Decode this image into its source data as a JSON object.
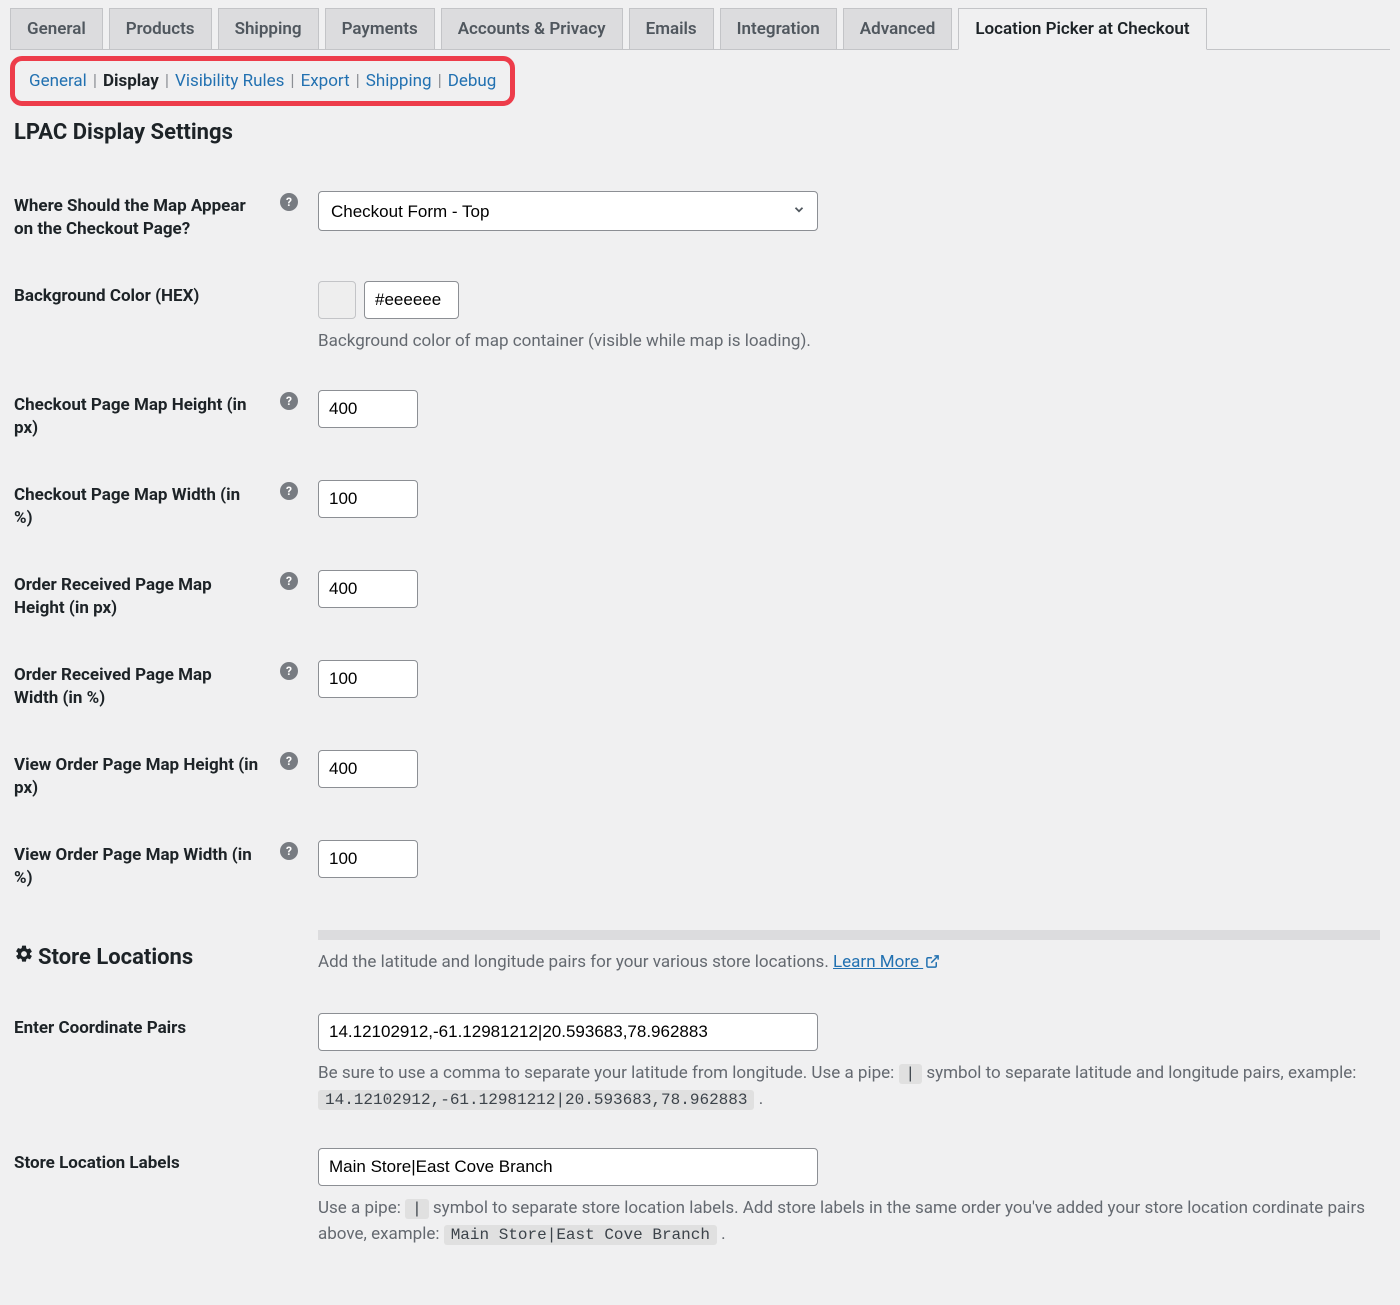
{
  "tabs": {
    "primary": [
      "General",
      "Products",
      "Shipping",
      "Payments",
      "Accounts & Privacy",
      "Emails",
      "Integration",
      "Advanced",
      "Location Picker at Checkout"
    ],
    "active_primary": 8,
    "secondary": [
      "General",
      "Display",
      "Visibility Rules",
      "Export",
      "Shipping",
      "Debug"
    ],
    "active_secondary": 1
  },
  "page_title": "LPAC Display Settings",
  "fields": {
    "map_position": {
      "label": "Where Should the Map Appear on the Checkout Page?",
      "value": "Checkout Form - Top"
    },
    "bg_color": {
      "label": "Background Color (HEX)",
      "value": "#eeeeee",
      "desc": "Background color of map container (visible while map is loading)."
    },
    "checkout_height": {
      "label": "Checkout Page Map Height (in px)",
      "value": "400"
    },
    "checkout_width": {
      "label": "Checkout Page Map Width (in %)",
      "value": "100"
    },
    "order_received_height": {
      "label": "Order Received Page Map Height (in px)",
      "value": "400"
    },
    "order_received_width": {
      "label": "Order Received Page Map Width (in %)",
      "value": "100"
    },
    "view_order_height": {
      "label": "View Order Page Map Height (in px)",
      "value": "400"
    },
    "view_order_width": {
      "label": "View Order Page Map Width (in %)",
      "value": "100"
    }
  },
  "store_locations": {
    "heading": "Store Locations",
    "intro_prefix": "Add the latitude and longitude pairs for your various store locations. ",
    "learn_more": "Learn More ",
    "coord_label": "Enter Coordinate Pairs",
    "coord_value": "14.12102912,-61.12981212|20.593683,78.962883",
    "coord_desc_1": "Be sure to use a comma to separate your latitude from longitude. Use a pipe: ",
    "coord_pipe": "|",
    "coord_desc_2": " symbol to separate latitude and longitude pairs, example: ",
    "coord_example": "14.12102912,-61.12981212|20.593683,78.962883",
    "coord_desc_3": " .",
    "labels_label": "Store Location Labels",
    "labels_value": "Main Store|East Cove Branch",
    "labels_desc_1": "Use a pipe: ",
    "labels_desc_2": " symbol to separate store location labels. Add store labels in the same order you've added your store location cordinate pairs above, example: ",
    "labels_example": "Main Store|East Cove Branch",
    "labels_desc_3": " ."
  }
}
